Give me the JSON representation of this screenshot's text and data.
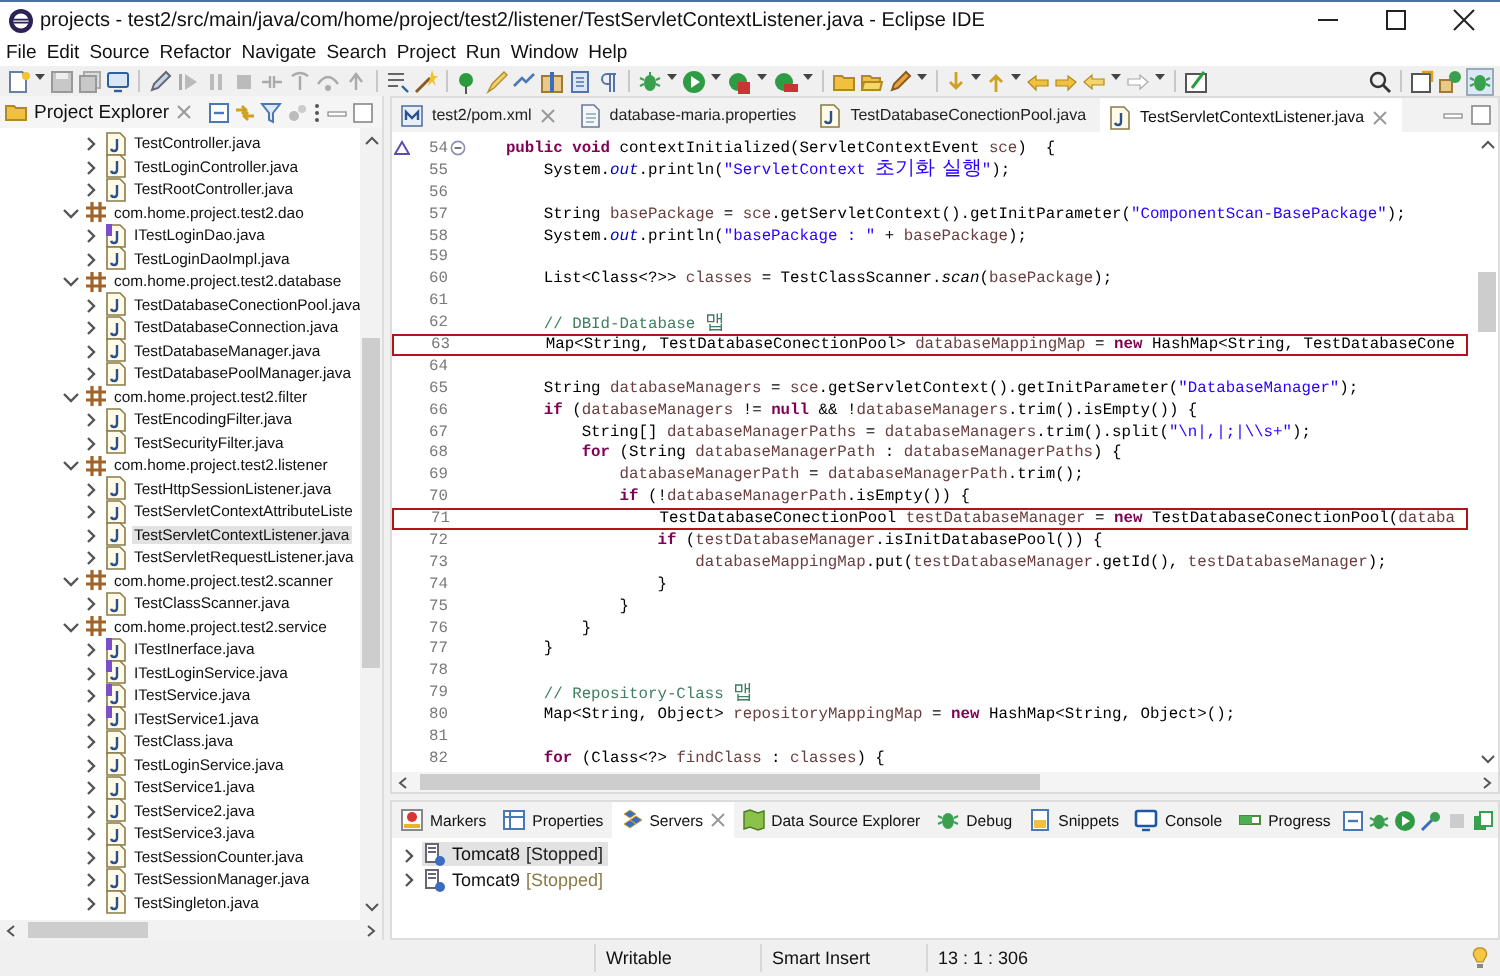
{
  "window": {
    "title": "projects - test2/src/main/java/com/home/project/test2/listener/TestServletContextListener.java - Eclipse IDE"
  },
  "menu": [
    "File",
    "Edit",
    "Source",
    "Refactor",
    "Navigate",
    "Search",
    "Project",
    "Run",
    "Window",
    "Help"
  ],
  "explorer": {
    "title": "Project Explorer",
    "items": [
      {
        "label": "TestController.java",
        "kind": "class",
        "expanded": false,
        "selected": false
      },
      {
        "label": "TestLoginController.java",
        "kind": "class",
        "expanded": false,
        "selected": false
      },
      {
        "label": "TestRootController.java",
        "kind": "class",
        "expanded": false,
        "selected": false
      },
      {
        "label": "com.home.project.test2.dao",
        "kind": "package",
        "expanded": true,
        "selected": false,
        "children": [
          {
            "label": "ITestLoginDao.java",
            "kind": "interface",
            "expanded": false,
            "selected": false
          },
          {
            "label": "TestLoginDaoImpl.java",
            "kind": "class",
            "expanded": false,
            "selected": false
          }
        ]
      },
      {
        "label": "com.home.project.test2.database",
        "kind": "package",
        "expanded": true,
        "selected": false,
        "children": [
          {
            "label": "TestDatabaseConectionPool.java",
            "kind": "class",
            "expanded": false,
            "selected": false
          },
          {
            "label": "TestDatabaseConnection.java",
            "kind": "class",
            "expanded": false,
            "selected": false
          },
          {
            "label": "TestDatabaseManager.java",
            "kind": "class",
            "expanded": false,
            "selected": false
          },
          {
            "label": "TestDatabasePoolManager.java",
            "kind": "class",
            "expanded": false,
            "selected": false
          }
        ]
      },
      {
        "label": "com.home.project.test2.filter",
        "kind": "package",
        "expanded": true,
        "selected": false,
        "children": [
          {
            "label": "TestEncodingFilter.java",
            "kind": "class",
            "expanded": false,
            "selected": false
          },
          {
            "label": "TestSecurityFilter.java",
            "kind": "class",
            "expanded": false,
            "selected": false
          }
        ]
      },
      {
        "label": "com.home.project.test2.listener",
        "kind": "package",
        "expanded": true,
        "selected": false,
        "children": [
          {
            "label": "TestHttpSessionListener.java",
            "kind": "class",
            "expanded": false,
            "selected": false
          },
          {
            "label": "TestServletContextAttributeListe",
            "kind": "class",
            "expanded": false,
            "selected": false
          },
          {
            "label": "TestServletContextListener.java",
            "kind": "class",
            "expanded": false,
            "selected": true
          },
          {
            "label": "TestServletRequestListener.java",
            "kind": "class",
            "expanded": false,
            "selected": false
          }
        ]
      },
      {
        "label": "com.home.project.test2.scanner",
        "kind": "package",
        "expanded": true,
        "selected": false,
        "children": [
          {
            "label": "TestClassScanner.java",
            "kind": "class",
            "expanded": false,
            "selected": false
          }
        ]
      },
      {
        "label": "com.home.project.test2.service",
        "kind": "package",
        "expanded": true,
        "selected": false,
        "children": [
          {
            "label": "ITestInerface.java",
            "kind": "interface",
            "expanded": false,
            "selected": false
          },
          {
            "label": "ITestLoginService.java",
            "kind": "interface",
            "expanded": false,
            "selected": false
          },
          {
            "label": "ITestService.java",
            "kind": "interface",
            "expanded": false,
            "selected": false
          },
          {
            "label": "ITestService1.java",
            "kind": "interface",
            "expanded": false,
            "selected": false
          },
          {
            "label": "TestClass.java",
            "kind": "class",
            "expanded": false,
            "selected": false
          },
          {
            "label": "TestLoginService.java",
            "kind": "class",
            "expanded": false,
            "selected": false
          },
          {
            "label": "TestService1.java",
            "kind": "class",
            "expanded": false,
            "selected": false
          },
          {
            "label": "TestService2.java",
            "kind": "class",
            "expanded": false,
            "selected": false
          },
          {
            "label": "TestService3.java",
            "kind": "class",
            "expanded": false,
            "selected": false
          },
          {
            "label": "TestSessionCounter.java",
            "kind": "class",
            "expanded": false,
            "selected": false
          },
          {
            "label": "TestSessionManager.java",
            "kind": "class",
            "expanded": false,
            "selected": false
          },
          {
            "label": "TestSingleton.java",
            "kind": "class",
            "expanded": false,
            "selected": false
          }
        ]
      }
    ]
  },
  "editor": {
    "tabs": [
      {
        "label": "test2/pom.xml",
        "kind": "xml",
        "selected": false,
        "closable": true
      },
      {
        "label": "database-maria.properties",
        "kind": "properties",
        "selected": false,
        "closable": false
      },
      {
        "label": "TestDatabaseConectionPool.java",
        "kind": "java",
        "selected": false,
        "closable": false
      },
      {
        "label": "TestServletContextListener.java",
        "kind": "java",
        "selected": true,
        "closable": true
      }
    ],
    "lines": [
      {
        "number": "54",
        "fold": true,
        "override": true,
        "boxed": false,
        "tokens": [
          {
            "text": "    public void",
            "kind": "keyword"
          },
          {
            "text": " contextInitialized(ServletContextEvent ",
            "kind": "plain"
          },
          {
            "text": "sce",
            "kind": "variable"
          },
          {
            "text": ")  {",
            "kind": "plain"
          }
        ]
      },
      {
        "number": "55",
        "fold": false,
        "override": false,
        "boxed": false,
        "tokens": [
          {
            "text": "        System.",
            "kind": "plain"
          },
          {
            "text": "out",
            "kind": "field"
          },
          {
            "text": ".println(",
            "kind": "plain"
          },
          {
            "text": "\"ServletContext ",
            "kind": "string"
          },
          {
            "text": "초기화 실행",
            "kind": "string-hangul"
          },
          {
            "text": "\"",
            "kind": "string"
          },
          {
            "text": ");",
            "kind": "plain"
          }
        ]
      },
      {
        "number": "56",
        "fold": false,
        "override": false,
        "boxed": false
      },
      {
        "number": "57",
        "fold": false,
        "override": false,
        "boxed": false,
        "tokens": [
          {
            "text": "        String ",
            "kind": "plain"
          },
          {
            "text": "basePackage",
            "kind": "variable"
          },
          {
            "text": " = ",
            "kind": "plain"
          },
          {
            "text": "sce",
            "kind": "variable"
          },
          {
            "text": ".getServletContext().getInitParameter(",
            "kind": "plain"
          },
          {
            "text": "\"ComponentScan-BasePackage\"",
            "kind": "string"
          },
          {
            "text": ");",
            "kind": "plain"
          }
        ]
      },
      {
        "number": "58",
        "fold": false,
        "override": false,
        "boxed": false,
        "tokens": [
          {
            "text": "        System.",
            "kind": "plain"
          },
          {
            "text": "out",
            "kind": "field"
          },
          {
            "text": ".println(",
            "kind": "plain"
          },
          {
            "text": "\"basePackage : \"",
            "kind": "string"
          },
          {
            "text": " + ",
            "kind": "plain"
          },
          {
            "text": "basePackage",
            "kind": "variable"
          },
          {
            "text": ");",
            "kind": "plain"
          }
        ]
      },
      {
        "number": "59",
        "fold": false,
        "override": false,
        "boxed": false
      },
      {
        "number": "60",
        "fold": false,
        "override": false,
        "boxed": false,
        "tokens": [
          {
            "text": "        List<Class<?>> ",
            "kind": "plain"
          },
          {
            "text": "classes",
            "kind": "variable"
          },
          {
            "text": " = TestClassScanner.",
            "kind": "plain"
          },
          {
            "text": "scan",
            "kind": "static"
          },
          {
            "text": "(",
            "kind": "plain"
          },
          {
            "text": "basePackage",
            "kind": "variable"
          },
          {
            "text": ");",
            "kind": "plain"
          }
        ]
      },
      {
        "number": "61",
        "fold": false,
        "override": false,
        "boxed": false
      },
      {
        "number": "62",
        "fold": false,
        "override": false,
        "boxed": false,
        "tokens": [
          {
            "text": "        // DBId-Database ",
            "kind": "comment"
          },
          {
            "text": "맵",
            "kind": "comment-hangul"
          }
        ]
      },
      {
        "number": "63",
        "fold": false,
        "override": false,
        "boxed": true,
        "tokens": [
          {
            "text": "        Map<String, TestDatabaseConectionPool> ",
            "kind": "plain"
          },
          {
            "text": "databaseMappingMap",
            "kind": "variable"
          },
          {
            "text": " = ",
            "kind": "plain"
          },
          {
            "text": "new",
            "kind": "keyword"
          },
          {
            "text": " HashMap<String, TestDatabaseCone",
            "kind": "plain"
          }
        ]
      },
      {
        "number": "64",
        "fold": false,
        "override": false,
        "boxed": false
      },
      {
        "number": "65",
        "fold": false,
        "override": false,
        "boxed": false,
        "tokens": [
          {
            "text": "        String ",
            "kind": "plain"
          },
          {
            "text": "databaseManagers",
            "kind": "variable"
          },
          {
            "text": " = ",
            "kind": "plain"
          },
          {
            "text": "sce",
            "kind": "variable"
          },
          {
            "text": ".getServletContext().getInitParameter(",
            "kind": "plain"
          },
          {
            "text": "\"DatabaseManager\"",
            "kind": "string"
          },
          {
            "text": ");",
            "kind": "plain"
          }
        ]
      },
      {
        "number": "66",
        "fold": false,
        "override": false,
        "boxed": false,
        "tokens": [
          {
            "text": "        if",
            "kind": "keyword"
          },
          {
            "text": " (",
            "kind": "plain"
          },
          {
            "text": "databaseManagers",
            "kind": "variable"
          },
          {
            "text": " != ",
            "kind": "plain"
          },
          {
            "text": "null",
            "kind": "keyword"
          },
          {
            "text": " && !",
            "kind": "plain"
          },
          {
            "text": "databaseManagers",
            "kind": "variable"
          },
          {
            "text": ".trim().isEmpty()) {",
            "kind": "plain"
          }
        ]
      },
      {
        "number": "67",
        "fold": false,
        "override": false,
        "boxed": false,
        "tokens": [
          {
            "text": "            String[] ",
            "kind": "plain"
          },
          {
            "text": "databaseManagerPaths",
            "kind": "variable"
          },
          {
            "text": " = ",
            "kind": "plain"
          },
          {
            "text": "databaseManagers",
            "kind": "variable"
          },
          {
            "text": ".trim().split(",
            "kind": "plain"
          },
          {
            "text": "\"\\n|,|;|\\\\s+\"",
            "kind": "string"
          },
          {
            "text": ");",
            "kind": "plain"
          }
        ]
      },
      {
        "number": "68",
        "fold": false,
        "override": false,
        "boxed": false,
        "tokens": [
          {
            "text": "            for",
            "kind": "keyword"
          },
          {
            "text": " (String ",
            "kind": "plain"
          },
          {
            "text": "databaseManagerPath",
            "kind": "variable"
          },
          {
            "text": " : ",
            "kind": "plain"
          },
          {
            "text": "databaseManagerPaths",
            "kind": "variable"
          },
          {
            "text": ") {",
            "kind": "plain"
          }
        ]
      },
      {
        "number": "69",
        "fold": false,
        "override": false,
        "boxed": false,
        "tokens": [
          {
            "text": "                databaseManagerPath",
            "kind": "variable"
          },
          {
            "text": " = ",
            "kind": "plain"
          },
          {
            "text": "databaseManagerPath",
            "kind": "variable"
          },
          {
            "text": ".trim();",
            "kind": "plain"
          }
        ]
      },
      {
        "number": "70",
        "fold": false,
        "override": false,
        "boxed": false,
        "tokens": [
          {
            "text": "                if",
            "kind": "keyword"
          },
          {
            "text": " (!",
            "kind": "plain"
          },
          {
            "text": "databaseManagerPath",
            "kind": "variable"
          },
          {
            "text": ".isEmpty()) {",
            "kind": "plain"
          }
        ]
      },
      {
        "number": "71",
        "fold": false,
        "override": false,
        "boxed": true,
        "tokens": [
          {
            "text": "                    TestDatabaseConectionPool ",
            "kind": "plain"
          },
          {
            "text": "testDatabaseManager",
            "kind": "variable"
          },
          {
            "text": " = ",
            "kind": "plain"
          },
          {
            "text": "new",
            "kind": "keyword"
          },
          {
            "text": " TestDatabaseConectionPool(",
            "kind": "plain"
          },
          {
            "text": "databa",
            "kind": "variable"
          }
        ]
      },
      {
        "number": "72",
        "fold": false,
        "override": false,
        "boxed": false,
        "tokens": [
          {
            "text": "                    if",
            "kind": "keyword"
          },
          {
            "text": " (",
            "kind": "plain"
          },
          {
            "text": "testDatabaseManager",
            "kind": "variable"
          },
          {
            "text": ".isInitDatabasePool()) {",
            "kind": "plain"
          }
        ]
      },
      {
        "number": "73",
        "fold": false,
        "override": false,
        "boxed": false,
        "tokens": [
          {
            "text": "                        databaseMappingMap",
            "kind": "variable"
          },
          {
            "text": ".put(",
            "kind": "plain"
          },
          {
            "text": "testDatabaseManager",
            "kind": "variable"
          },
          {
            "text": ".getId(), ",
            "kind": "plain"
          },
          {
            "text": "testDatabaseManager",
            "kind": "variable"
          },
          {
            "text": ");",
            "kind": "plain"
          }
        ]
      },
      {
        "number": "74",
        "fold": false,
        "override": false,
        "boxed": false,
        "tokens": [
          {
            "text": "                    }",
            "kind": "plain"
          }
        ]
      },
      {
        "number": "75",
        "fold": false,
        "override": false,
        "boxed": false,
        "tokens": [
          {
            "text": "                }",
            "kind": "plain"
          }
        ]
      },
      {
        "number": "76",
        "fold": false,
        "override": false,
        "boxed": false,
        "tokens": [
          {
            "text": "            }",
            "kind": "plain"
          }
        ]
      },
      {
        "number": "77",
        "fold": false,
        "override": false,
        "boxed": false,
        "tokens": [
          {
            "text": "        }",
            "kind": "plain"
          }
        ]
      },
      {
        "number": "78",
        "fold": false,
        "override": false,
        "boxed": false
      },
      {
        "number": "79",
        "fold": false,
        "override": false,
        "boxed": false,
        "tokens": [
          {
            "text": "        // Repository-Class ",
            "kind": "comment"
          },
          {
            "text": "맵",
            "kind": "comment-hangul"
          }
        ]
      },
      {
        "number": "80",
        "fold": false,
        "override": false,
        "boxed": false,
        "tokens": [
          {
            "text": "        Map<String, Object> ",
            "kind": "plain"
          },
          {
            "text": "repositoryMappingMap",
            "kind": "variable"
          },
          {
            "text": " = ",
            "kind": "plain"
          },
          {
            "text": "new",
            "kind": "keyword"
          },
          {
            "text": " HashMap<String, Object>();",
            "kind": "plain"
          }
        ]
      },
      {
        "number": "81",
        "fold": false,
        "override": false,
        "boxed": false
      },
      {
        "number": "82",
        "fold": false,
        "override": false,
        "boxed": false,
        "tokens": [
          {
            "text": "        for",
            "kind": "keyword"
          },
          {
            "text": " (Class<?> ",
            "kind": "plain"
          },
          {
            "text": "findClass",
            "kind": "variable"
          },
          {
            "text": " : ",
            "kind": "plain"
          },
          {
            "text": "classes",
            "kind": "variable"
          },
          {
            "text": ") {",
            "kind": "plain"
          }
        ]
      }
    ]
  },
  "bottom_panel": {
    "tabs": [
      {
        "label": "Markers",
        "selected": false,
        "closable": false
      },
      {
        "label": "Properties",
        "selected": false,
        "closable": false
      },
      {
        "label": "Servers",
        "selected": true,
        "closable": true
      },
      {
        "label": "Data Source Explorer",
        "selected": false,
        "closable": false
      },
      {
        "label": "Debug",
        "selected": false,
        "closable": false
      },
      {
        "label": "Snippets",
        "selected": false,
        "closable": false
      },
      {
        "label": "Console",
        "selected": false,
        "closable": false
      },
      {
        "label": "Progress",
        "selected": false,
        "closable": false
      }
    ],
    "servers": [
      {
        "name": "Tomcat8",
        "state": "[Stopped]",
        "selected": true,
        "expanded": false
      },
      {
        "name": "Tomcat9",
        "state": "[Stopped]",
        "selected": false,
        "expanded": false
      }
    ]
  },
  "status_bar": [
    "Writable",
    "Smart Insert",
    "13 : 1 : 306"
  ]
}
